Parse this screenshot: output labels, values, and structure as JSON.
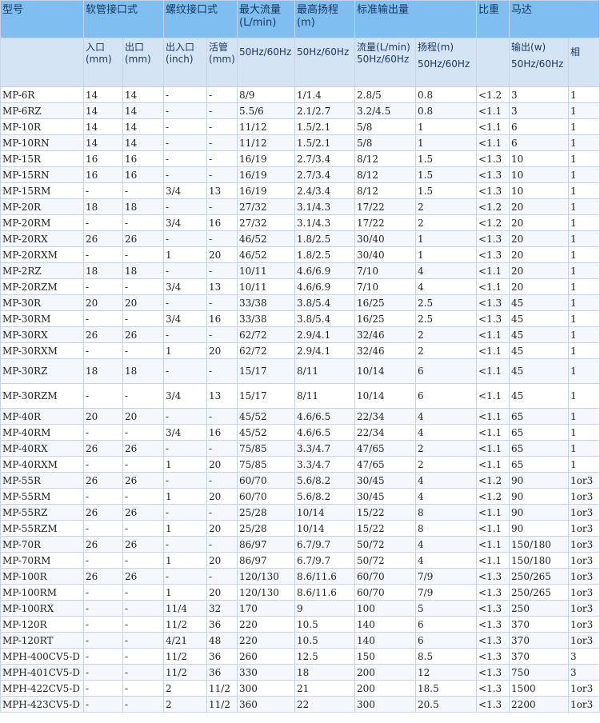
{
  "headers": {
    "model": "型号",
    "hose": "软管接口式",
    "thread": "螺纹接口式",
    "max_flow": "最大流量(L/min)",
    "max_head": "最高扬程(m)",
    "std_output": "标准输出量",
    "gravity": "比重",
    "motor": "马达",
    "hose_in": "入口(mm)",
    "hose_out": "出口(mm)",
    "thread_io": "出入口(inch)",
    "thread_union": "活管(mm)",
    "hz_flow": "50Hz/60Hz",
    "hz_head": "50Hz/60Hz",
    "std_flow": "流量(L/min)",
    "std_flow_hz": "50Hz/60Hz",
    "std_head": "扬程(m)",
    "std_head_hz": "50Hz/60Hz",
    "output_w": "输出(w)",
    "output_hz": "50Hz/60Hz",
    "phase": "相"
  },
  "rows": [
    [
      "MP-6R",
      "14",
      "14",
      "-",
      "-",
      "8/9",
      "1/1.4",
      "2.8/5",
      "0.8",
      "<1.2",
      "3",
      "1"
    ],
    [
      "MP-6RZ",
      "14",
      "14",
      "-",
      "-",
      "5.5/6",
      "2.1/2.7",
      "3.2/4.5",
      "0.8",
      "<1.1",
      "3",
      "1"
    ],
    [
      "MP-10R",
      "14",
      "14",
      "-",
      "-",
      "11/12",
      "1.5/2.1",
      "5/8",
      "1",
      "<1.1",
      "6",
      "1"
    ],
    [
      "MP-10RN",
      "14",
      "14",
      "-",
      "-",
      "11/12",
      "1.5/2.1",
      "5/8",
      "1",
      "<1.1",
      "6",
      "1"
    ],
    [
      "MP-15R",
      "16",
      "16",
      "-",
      "-",
      "16/19",
      "2.7/3.4",
      "8/12",
      "1.5",
      "<1.3",
      "10",
      "1"
    ],
    [
      "MP-15RN",
      "16",
      "16",
      "-",
      "-",
      "16/19",
      "2.7/3.4",
      "8/12",
      "1.5",
      "<1.3",
      "10",
      "1"
    ],
    [
      "MP-15RM",
      "-",
      "-",
      "3/4",
      "13",
      "16/19",
      "2.4/3.4",
      "8/12",
      "1.5",
      "<1.3",
      "10",
      "1"
    ],
    [
      "MP-20R",
      "18",
      "18",
      "-",
      "-",
      "27/32",
      "3.1/4.3",
      "17/22",
      "2",
      "<1.2",
      "20",
      "1"
    ],
    [
      "MP-20RM",
      "-",
      "-",
      "3/4",
      "16",
      "27/32",
      "3.1/4.3",
      "17/22",
      "2",
      "<1.2",
      "20",
      "1"
    ],
    [
      "MP-20RX",
      "26",
      "26",
      "-",
      "-",
      "46/52",
      "1.8/2.5",
      "30/40",
      "1",
      "<1.3",
      "20",
      "1"
    ],
    [
      "MP-20RXM",
      "-",
      "-",
      "1",
      "20",
      "46/52",
      "1.8/2.5",
      "30/40",
      "1",
      "<1.3",
      "20",
      "1"
    ],
    [
      "MP-2RZ",
      "18",
      "18",
      "-",
      "-",
      "10/11",
      "4.6/6.9",
      "7/10",
      "4",
      "<1.1",
      "20",
      "1"
    ],
    [
      "MP-20RZM",
      "-",
      "-",
      "3/4",
      "13",
      "10/11",
      "4.6/6.9",
      "7/10",
      "4",
      "<1.1",
      "20",
      "1"
    ],
    [
      "MP-30R",
      "20",
      "20",
      "-",
      "-",
      "33/38",
      "3.8/5.4",
      "16/25",
      "2.5",
      "<1.3",
      "45",
      "1"
    ],
    [
      "MP-30RM",
      "-",
      "-",
      "3/4",
      "16",
      "33/38",
      "3.8/5.4",
      "16/25",
      "2.5",
      "<1.3",
      "45",
      "1"
    ],
    [
      "MP-30RX",
      "26",
      "26",
      "-",
      "-",
      "62/72",
      "2.9/4.1",
      "32/46",
      "2",
      "<1.1",
      "45",
      "1"
    ],
    [
      "MP-30RXM",
      "-",
      "-",
      "1",
      "20",
      "62/72",
      "2.9/4.1",
      "32/46",
      "2",
      "<1.1",
      "45",
      "1"
    ],
    [
      "MP-30RZ",
      "18",
      "18",
      "-",
      "-",
      "15/17",
      "8/11",
      "10/14",
      "6",
      "<1.1",
      "45",
      "1"
    ],
    [
      "MP-30RZM",
      "-",
      "-",
      "3/4",
      "13",
      "15/17",
      "8/11",
      "10/14",
      "6",
      "<1.1",
      "45",
      "1"
    ],
    [
      "MP-40R",
      "20",
      "20",
      "-",
      "-",
      "45/52",
      "4.6/6.5",
      "22/34",
      "4",
      "<1.1",
      "65",
      "1"
    ],
    [
      "MP-40RM",
      "-",
      "-",
      "3/4",
      "16",
      "45/52",
      "4.6/6.5",
      "22/34",
      "4",
      "<1.1",
      "65",
      "1"
    ],
    [
      "MP-40RX",
      "26",
      "26",
      "-",
      "-",
      "75/85",
      "3.3/4.7",
      "47/65",
      "2",
      "<1.1",
      "65",
      "1"
    ],
    [
      "MP-40RXM",
      "-",
      "-",
      "1",
      "20",
      "75/85",
      "3.3/4.7",
      "47/65",
      "2",
      "<1.1",
      "65",
      "1"
    ],
    [
      "MP-55R",
      "26",
      "26",
      "-",
      "-",
      "60/70",
      "5.6/8.2",
      "30/45",
      "4",
      "<1.2",
      "90",
      "1or3"
    ],
    [
      "MP-55RM",
      "-",
      "-",
      "1",
      "20",
      "60/70",
      "5.6/8.2",
      "30/45",
      "4",
      "<1.2",
      "90",
      "1or3"
    ],
    [
      "MP-55RZ",
      "26",
      "26",
      "-",
      "-",
      "25/28",
      "10/14",
      "15/22",
      "8",
      "<1.1",
      "90",
      "1or3"
    ],
    [
      "MP-55RZM",
      "-",
      "-",
      "1",
      "20",
      "25/28",
      "10/14",
      "15/22",
      "8",
      "<1.1",
      "90",
      "1or3"
    ],
    [
      "MP-70R",
      "26",
      "26",
      "-",
      "-",
      "86/97",
      "6.7/9.7",
      "50/72",
      "4",
      "<1.1",
      "150/180",
      "1or3"
    ],
    [
      "MP-70RM",
      "-",
      "-",
      "1",
      "20",
      "86/97",
      "6.7/9.7",
      "50/72",
      "4",
      "<1.1",
      "150/180",
      "1or3"
    ],
    [
      "MP-100R",
      "26",
      "26",
      "-",
      "-",
      "120/130",
      "8.6/11.6",
      "60/70",
      "7/9",
      "<1.3",
      "250/265",
      "1or3"
    ],
    [
      "MP-100RM",
      "-",
      "-",
      "1",
      "20",
      "120/130",
      "8.6/11.6",
      "60/70",
      "7/9",
      "<1.3",
      "250/265",
      "1or3"
    ],
    [
      "MP-100RX",
      "-",
      "-",
      "11/4",
      "32",
      "170",
      "9",
      "100",
      "5",
      "<1.3",
      "250",
      "1or3"
    ],
    [
      "MP-120R",
      "-",
      "-",
      "11/2",
      "36",
      "220",
      "10.5",
      "140",
      "6",
      "<1.3",
      "370",
      "1or3"
    ],
    [
      "MP-120RT",
      "-",
      "-",
      "4/21",
      "48",
      "220",
      "10.5",
      "140",
      "6",
      "<1.3",
      "370",
      "1or3"
    ],
    [
      "MPH-400CV5-D",
      "-",
      "-",
      "11/2",
      "36",
      "260",
      "12.5",
      "150",
      "8.5",
      "<1.3",
      "370",
      "3"
    ],
    [
      "MPH-401CV5-D",
      "-",
      "-",
      "11/2",
      "36",
      "330",
      "18",
      "200",
      "12",
      "<1.3",
      "750",
      "3"
    ],
    [
      "MPH-422CV5-D",
      "-",
      "-",
      "2",
      "11/2",
      "300",
      "21",
      "200",
      "18.5",
      "<1.3",
      "1500",
      "1or3"
    ],
    [
      "MPH-423CV5-D",
      "-",
      "-",
      "2",
      "11/2",
      "360",
      "22",
      "300",
      "20.5",
      "<1.3",
      "2200",
      "1or3"
    ]
  ]
}
